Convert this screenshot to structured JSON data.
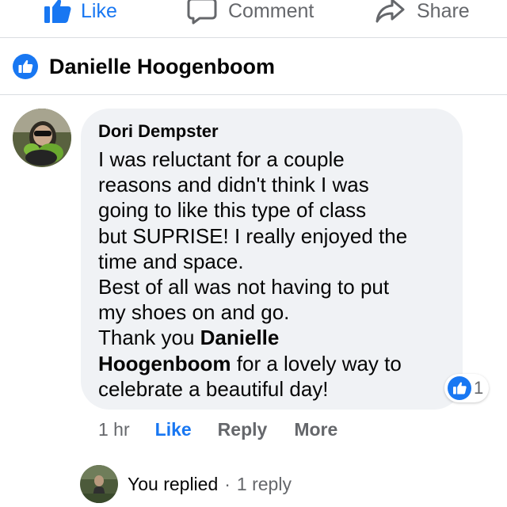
{
  "action_bar": {
    "like_label": "Like",
    "comment_label": "Comment",
    "share_label": "Share"
  },
  "liker": {
    "name": "Danielle Hoogenboom",
    "badge_icon": "like-badge-icon"
  },
  "comment": {
    "author": "Dori Dempster",
    "lines": [
      "I was reluctant for a couple",
      "reasons and didn't think I was",
      "going to like this type of class",
      "but SUPRISE! I really enjoyed the",
      "time and space.",
      "Best of all was not having to put",
      "my shoes on and go.",
      "Thank you ",
      "Danielle",
      "Hoogenboom",
      " for a lovely way to",
      "celebrate a beautiful day!"
    ],
    "reaction_count": "1",
    "time": "1 hr",
    "like_label": "Like",
    "reply_label": "Reply",
    "more_label": "More"
  },
  "replies": {
    "you_replied": "You replied",
    "separator": "·",
    "count_label": "1 reply"
  },
  "colors": {
    "accent": "#1877f2",
    "secondary_text": "#65676b",
    "bubble": "#f0f2f5"
  }
}
